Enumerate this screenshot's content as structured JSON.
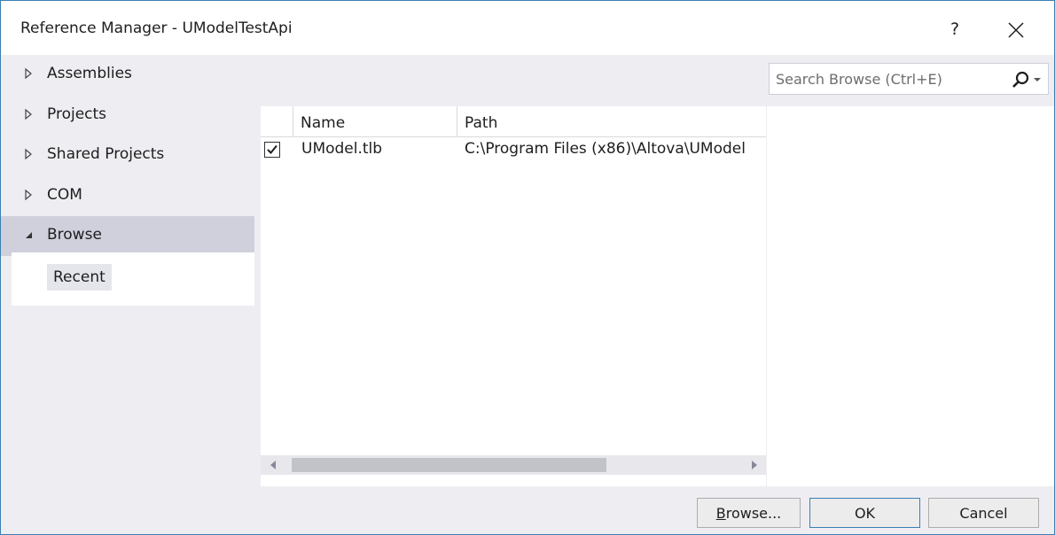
{
  "window": {
    "title": "Reference Manager - UModelTestApi",
    "help_label": "?"
  },
  "nav": {
    "items": [
      {
        "label": "Assemblies",
        "expanded": false
      },
      {
        "label": "Projects",
        "expanded": false
      },
      {
        "label": "Shared Projects",
        "expanded": false
      },
      {
        "label": "COM",
        "expanded": false
      },
      {
        "label": "Browse",
        "expanded": true,
        "selected": true
      }
    ],
    "sub_items": [
      {
        "label": "Recent"
      }
    ]
  },
  "search": {
    "placeholder": "Search Browse (Ctrl+E)"
  },
  "list": {
    "columns": [
      "Name",
      "Path"
    ],
    "rows": [
      {
        "checked": true,
        "name": "UModel.tlb",
        "path": "C:\\Program Files (x86)\\Altova\\UModel"
      }
    ]
  },
  "buttons": {
    "browse": {
      "accel": "B",
      "rest": "rowse..."
    },
    "ok": "OK",
    "cancel": "Cancel"
  },
  "colors": {
    "accent": "#3c7fb1",
    "selected_nav": "#cfd0dc",
    "dialog_bg": "#eeeef2"
  }
}
